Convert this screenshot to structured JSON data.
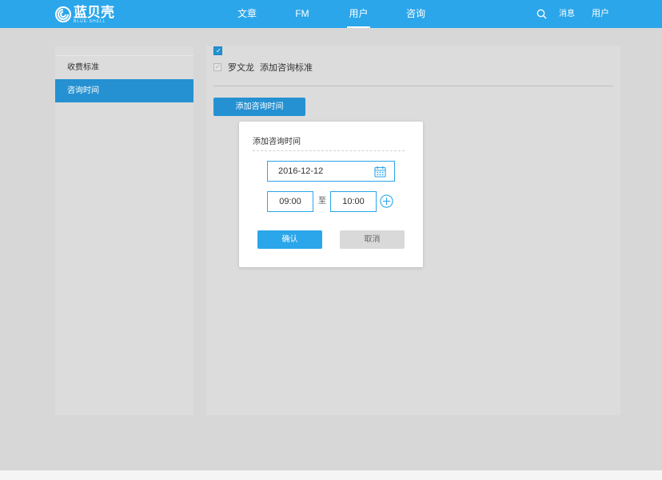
{
  "header": {
    "logo_text": "蓝贝壳",
    "logo_subtext": "BLUE-SHELL",
    "nav": [
      {
        "label": "文章"
      },
      {
        "label": "FM"
      },
      {
        "label": "用户"
      },
      {
        "label": "咨询"
      }
    ],
    "active_nav": "用户",
    "messages_label": "消息",
    "user_label": "用户",
    "accent_color": "#2ba6ea"
  },
  "sidebar": {
    "items": [
      {
        "label": "收费标准"
      },
      {
        "label": "咨询时间"
      }
    ],
    "active_item": "咨询时间"
  },
  "main": {
    "row": {
      "name": "罗文龙",
      "action": "添加咨询标准"
    },
    "add_button_label": "添加咨询时间"
  },
  "dialog": {
    "title": "添加咨询时间",
    "date_value": "2016-12-12",
    "start_time": "09:00",
    "to_label": "至",
    "end_time": "10:00",
    "confirm_label": "确认",
    "cancel_label": "取消"
  }
}
